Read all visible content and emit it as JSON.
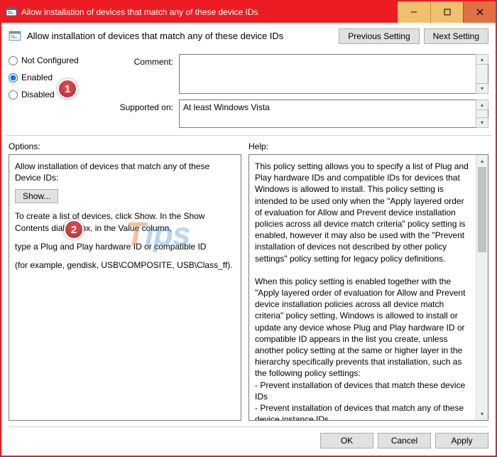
{
  "window": {
    "title": "Allow installation of devices that match any of these device IDs"
  },
  "header": {
    "title": "Allow installation of devices that match any of these device IDs",
    "prev": "Previous Setting",
    "next": "Next Setting"
  },
  "radios": {
    "not_configured": "Not Configured",
    "enabled": "Enabled",
    "disabled": "Disabled",
    "selected": "enabled"
  },
  "fields": {
    "comment_label": "Comment:",
    "comment_value": "",
    "supported_label": "Supported on:",
    "supported_value": "At least Windows Vista"
  },
  "section_labels": {
    "options": "Options:",
    "help": "Help:"
  },
  "options": {
    "title": "Allow installation of devices that match any of these Device IDs:",
    "show": "Show...",
    "p1": "To create a list of devices, click Show. In the Show Contents dialog box, in the Value column,",
    "p2": "type a Plug and Play hardware ID or compatible ID",
    "p3": "(for example, gendisk, USB\\COMPOSITE, USB\\Class_ff)."
  },
  "help_text": "This policy setting allows you to specify a list of Plug and Play hardware IDs and compatible IDs for devices that Windows is allowed to install. This policy setting is intended to be used only when the \"Apply layered order of evaluation for Allow and Prevent device installation policies across all device match criteria\" policy setting is enabled, however it may also be used with the \"Prevent installation of devices not described by other policy settings\" policy setting for legacy policy definitions.\n\nWhen this policy setting is enabled together with the \"Apply layered order of evaluation for Allow and Prevent device installation policies across all device match criteria\" policy setting, Windows is allowed to install or update any device whose Plug and Play hardware ID or compatible ID appears in the list you create, unless another policy setting at the same or higher layer in the hierarchy specifically prevents that installation, such as the following policy settings:\n- Prevent installation of devices that match these device IDs\n- Prevent installation of devices that match any of these device instance IDs\nIf the \"Apply layered order of evaluation for Allow and Prevent",
  "footer": {
    "ok": "OK",
    "cancel": "Cancel",
    "apply": "Apply"
  },
  "markers": {
    "m1": "1",
    "m2": "2"
  }
}
